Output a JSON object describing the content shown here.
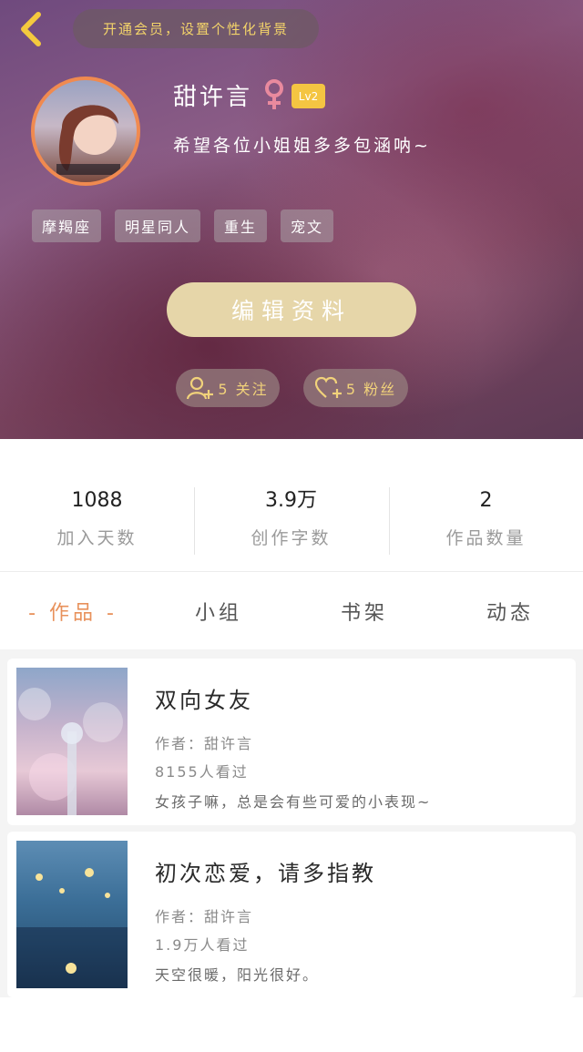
{
  "header": {
    "vip_prompt": "开通会员，设置个性化背景",
    "username": "甜许言",
    "level": "Lv2",
    "bio": "希望各位小姐姐多多包涵呐~",
    "tags": [
      "摩羯座",
      "明星同人",
      "重生",
      "宠文"
    ],
    "edit_label": "编辑资料",
    "follow_label": "5 关注",
    "fans_label": "5 粉丝",
    "colors": {
      "accent_gold": "#f1d27a",
      "avatar_ring": "#f08a50",
      "level_badge": "#f4c542",
      "gender_icon": "#e98a9e"
    }
  },
  "stats": [
    {
      "value": "1088",
      "label": "加入天数"
    },
    {
      "value": "3.9万",
      "label": "创作字数"
    },
    {
      "value": "2",
      "label": "作品数量"
    }
  ],
  "tabs": [
    {
      "label": "- 作品 -",
      "active": true
    },
    {
      "label": "小组"
    },
    {
      "label": "书架"
    },
    {
      "label": "动态"
    }
  ],
  "works": [
    {
      "title": "双向女友",
      "author": "作者：甜许言",
      "views": "8155人看过",
      "desc": "女孩子嘛，总是会有些可爱的小表现~"
    },
    {
      "title": "初次恋爱，请多指教",
      "author": "作者：甜许言",
      "views": "1.9万人看过",
      "desc": "天空很暖，阳光很好。"
    }
  ],
  "icons": {
    "back": "chevron-left-icon",
    "gender": "female-icon",
    "follow": "user-plus-icon",
    "fans": "heart-plus-icon"
  }
}
